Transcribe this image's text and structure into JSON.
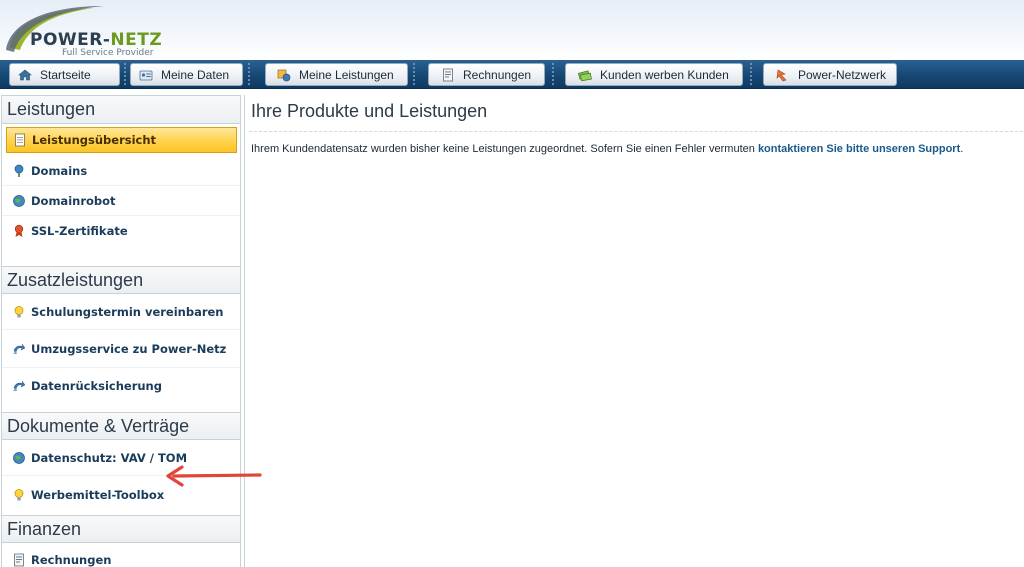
{
  "logo": {
    "brand_part1": "POWER-",
    "brand_part2": "NETZ",
    "tagline": "Full Service Provider",
    "brand_color": "#6b9a1f"
  },
  "nav": {
    "items": [
      {
        "label": "Startseite",
        "icon": "home-icon"
      },
      {
        "label": "Meine Daten",
        "icon": "id-card-icon"
      },
      {
        "label": "Meine Leistungen",
        "icon": "services-icon"
      },
      {
        "label": "Rechnungen",
        "icon": "invoice-icon"
      },
      {
        "label": "Kunden werben Kunden",
        "icon": "money-icon"
      },
      {
        "label": "Power-Netzwerk",
        "icon": "network-icon"
      }
    ]
  },
  "sidebar": {
    "sections": [
      {
        "title": "Leistungen",
        "items": [
          {
            "label": "Leistungsübersicht",
            "icon": "document-icon",
            "active": true
          },
          {
            "label": "Domains",
            "icon": "domain-pin-icon"
          },
          {
            "label": "Domainrobot",
            "icon": "globe-icon"
          },
          {
            "label": "SSL-Zertifikate",
            "icon": "certificate-icon"
          }
        ]
      },
      {
        "title": "Zusatzleistungen",
        "items": [
          {
            "label": "Schulungstermin vereinbaren",
            "icon": "lightbulb-icon"
          },
          {
            "label": "Umzugsservice zu Power-Netz",
            "icon": "transfer-icon"
          },
          {
            "label": "Datenrücksicherung",
            "icon": "transfer-icon"
          }
        ]
      },
      {
        "title": "Dokumente & Verträge",
        "items": [
          {
            "label": "Datenschutz: VAV / TOM",
            "icon": "globe-icon"
          },
          {
            "label": "Werbemittel-Toolbox",
            "icon": "lightbulb-icon"
          }
        ]
      },
      {
        "title": "Finanzen",
        "items": [
          {
            "label": "Rechnungen",
            "icon": "invoice-icon"
          }
        ]
      }
    ]
  },
  "main": {
    "title": "Ihre Produkte und Leistungen",
    "message_text": "Ihrem Kundendatensatz wurden bisher keine Leistungen zugeordnet. Sofern Sie einen Fehler vermuten ",
    "message_link": "kontaktieren Sie bitte unseren Support",
    "message_end": "."
  },
  "colors": {
    "nav_bg": "#164874",
    "active_item": "#ffd34a",
    "link": "#1a5b8d",
    "annotation_arrow": "#e0453a"
  }
}
